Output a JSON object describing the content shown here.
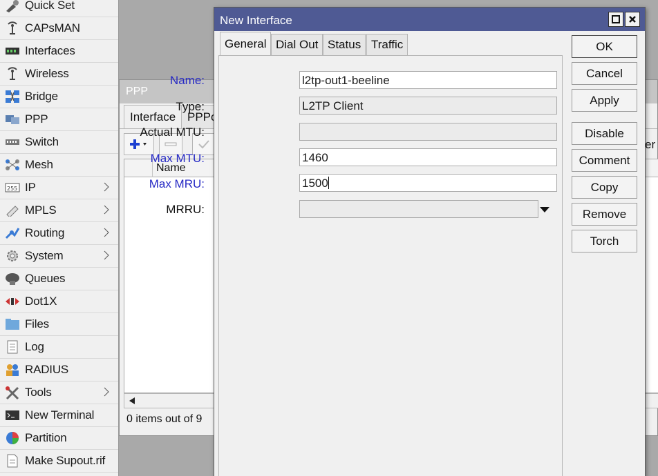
{
  "sidebar": {
    "items": [
      {
        "label": "Quick Set",
        "icon": "quick-set-icon",
        "submenu": false
      },
      {
        "label": "CAPsMAN",
        "icon": "antenna-icon",
        "submenu": false
      },
      {
        "label": "Interfaces",
        "icon": "interfaces-icon",
        "submenu": false
      },
      {
        "label": "Wireless",
        "icon": "antenna-icon",
        "submenu": false
      },
      {
        "label": "Bridge",
        "icon": "bridge-icon",
        "submenu": false
      },
      {
        "label": "PPP",
        "icon": "ppp-icon",
        "submenu": false
      },
      {
        "label": "Switch",
        "icon": "switch-icon",
        "submenu": false
      },
      {
        "label": "Mesh",
        "icon": "mesh-icon",
        "submenu": false
      },
      {
        "label": "IP",
        "icon": "ip-icon",
        "submenu": true
      },
      {
        "label": "MPLS",
        "icon": "mpls-icon",
        "submenu": true
      },
      {
        "label": "Routing",
        "icon": "routing-icon",
        "submenu": true
      },
      {
        "label": "System",
        "icon": "gear-icon",
        "submenu": true
      },
      {
        "label": "Queues",
        "icon": "queues-icon",
        "submenu": false
      },
      {
        "label": "Dot1X",
        "icon": "dot1x-icon",
        "submenu": false
      },
      {
        "label": "Files",
        "icon": "folder-icon",
        "submenu": false
      },
      {
        "label": "Log",
        "icon": "log-icon",
        "submenu": false
      },
      {
        "label": "RADIUS",
        "icon": "radius-icon",
        "submenu": false
      },
      {
        "label": "Tools",
        "icon": "tools-icon",
        "submenu": true
      },
      {
        "label": "New Terminal",
        "icon": "terminal-icon",
        "submenu": false
      },
      {
        "label": "Partition",
        "icon": "pie-chart-icon",
        "submenu": false
      },
      {
        "label": "Make Supout.rif",
        "icon": "document-icon",
        "submenu": false
      }
    ]
  },
  "ppp_window": {
    "title": "PPP",
    "tabs": [
      "Interface",
      "PPPo"
    ],
    "table_columns": [
      "Name"
    ],
    "status": "0 items out of 9",
    "peer_fragment": "er"
  },
  "dialog": {
    "title": "New Interface",
    "tabs": [
      "General",
      "Dial Out",
      "Status",
      "Traffic"
    ],
    "active_tab": "General",
    "fields": {
      "name": {
        "label": "Name:",
        "value": "l2tp-out1-beeline"
      },
      "type": {
        "label": "Type:",
        "value": "L2TP Client"
      },
      "actual_mtu": {
        "label": "Actual MTU:",
        "value": ""
      },
      "max_mtu": {
        "label": "Max MTU:",
        "value": "1460"
      },
      "max_mru": {
        "label": "Max MRU:",
        "value": "1500"
      },
      "mrru": {
        "label": "MRRU:",
        "value": ""
      }
    },
    "buttons": {
      "ok": "OK",
      "cancel": "Cancel",
      "apply": "Apply",
      "disable": "Disable",
      "comment": "Comment",
      "copy": "Copy",
      "remove": "Remove",
      "torch": "Torch"
    }
  },
  "colors": {
    "dialog_titlebar": "#4f5a94",
    "label_blue": "#2528c4",
    "inactive_titlebar": "#c5c5c5",
    "add_icon_blue": "#1c3fd1"
  }
}
